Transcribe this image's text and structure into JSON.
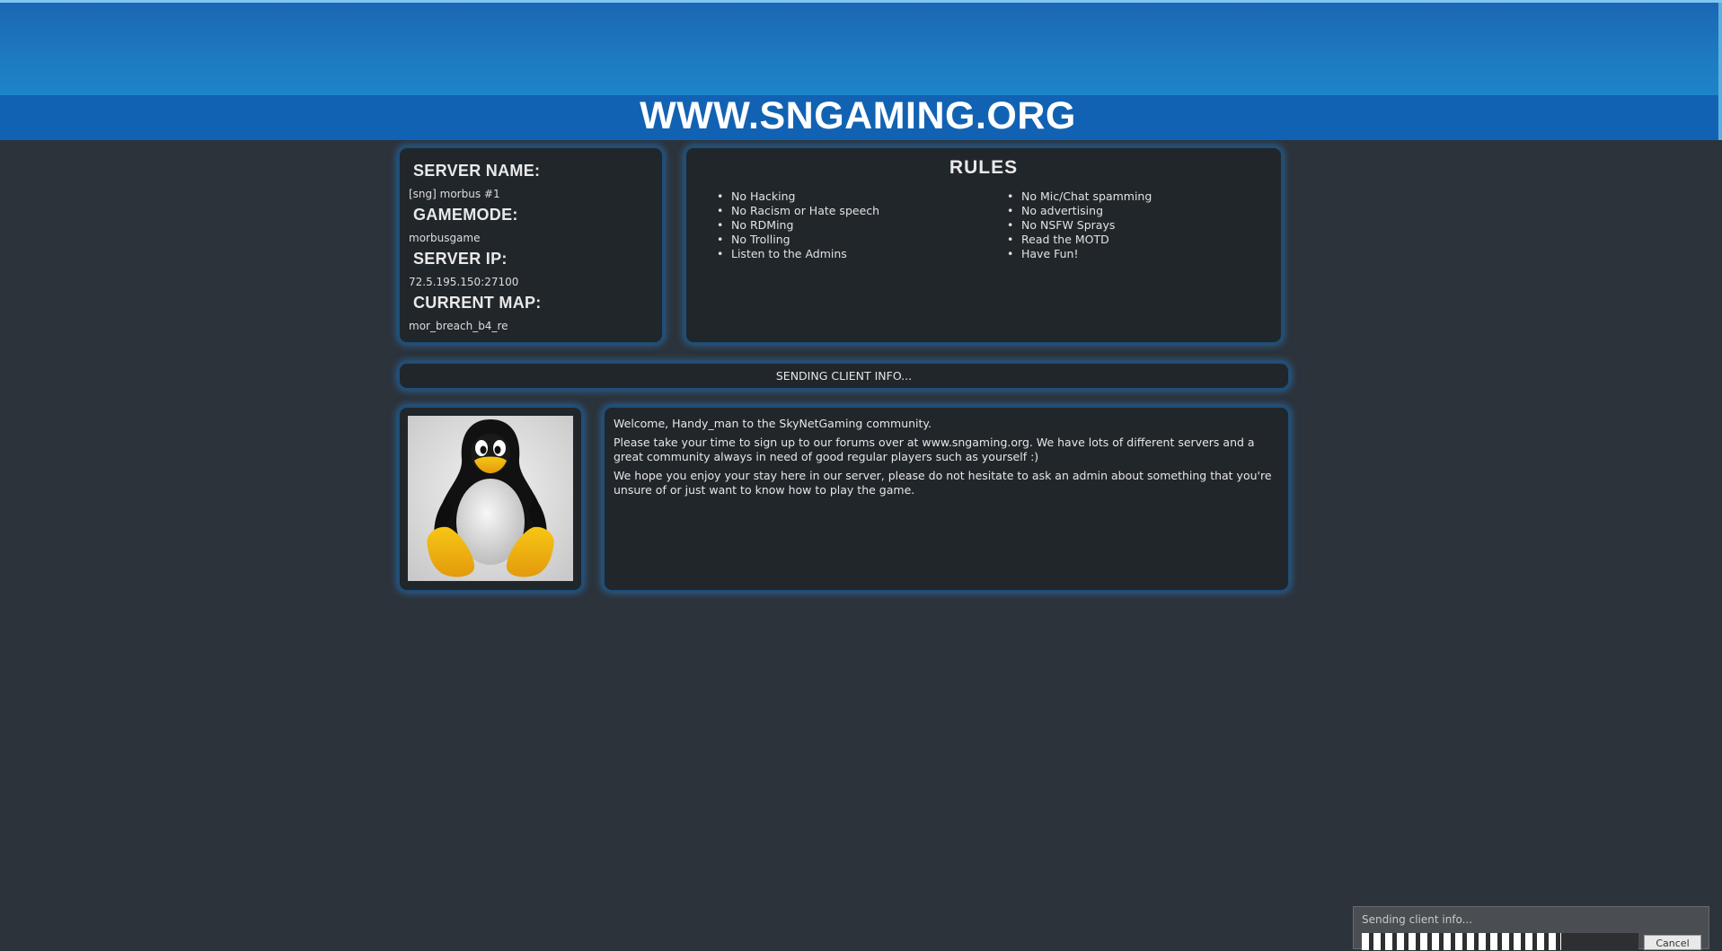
{
  "header": {
    "site_title": "WWW.SNGAMING.ORG"
  },
  "server": {
    "name_label": "SERVER NAME:",
    "name_value": "[sng] morbus #1",
    "gamemode_label": "GAMEMODE:",
    "gamemode_value": "morbusgame",
    "ip_label": "SERVER IP:",
    "ip_value": "72.5.195.150:27100",
    "map_label": "CURRENT MAP:",
    "map_value": "mor_breach_b4_re"
  },
  "rules": {
    "title": "RULES",
    "left": [
      "No Hacking",
      "No Racism or Hate speech",
      "No RDMing",
      "No Trolling",
      "Listen to the Admins"
    ],
    "right": [
      "No Mic/Chat spamming",
      "No advertising",
      "No NSFW Sprays",
      "Read the MOTD",
      "Have Fun!"
    ]
  },
  "status": {
    "text": "SENDING CLIENT INFO..."
  },
  "avatar": {
    "icon": "penguin-icon"
  },
  "welcome": {
    "line1": "Welcome, Handy_man to the SkyNetGaming community.",
    "line2": "Please take your time to sign up to our forums over at www.sngaming.org. We have lots of different servers and a great community always in need of good regular players such as yourself :)",
    "line3": "We hope you enjoy your stay here in our server, please do not hesitate to ask an admin about something that you're unsure of or just want to know how to play the game."
  },
  "dialog": {
    "text": "Sending client info...",
    "progress": 0.72,
    "cancel_label": "Cancel"
  },
  "colors": {
    "header_blue": "#1262b4",
    "panel_bg": "#21262b",
    "panel_glow": "#2882d2",
    "page_bg": "#2c333b"
  }
}
